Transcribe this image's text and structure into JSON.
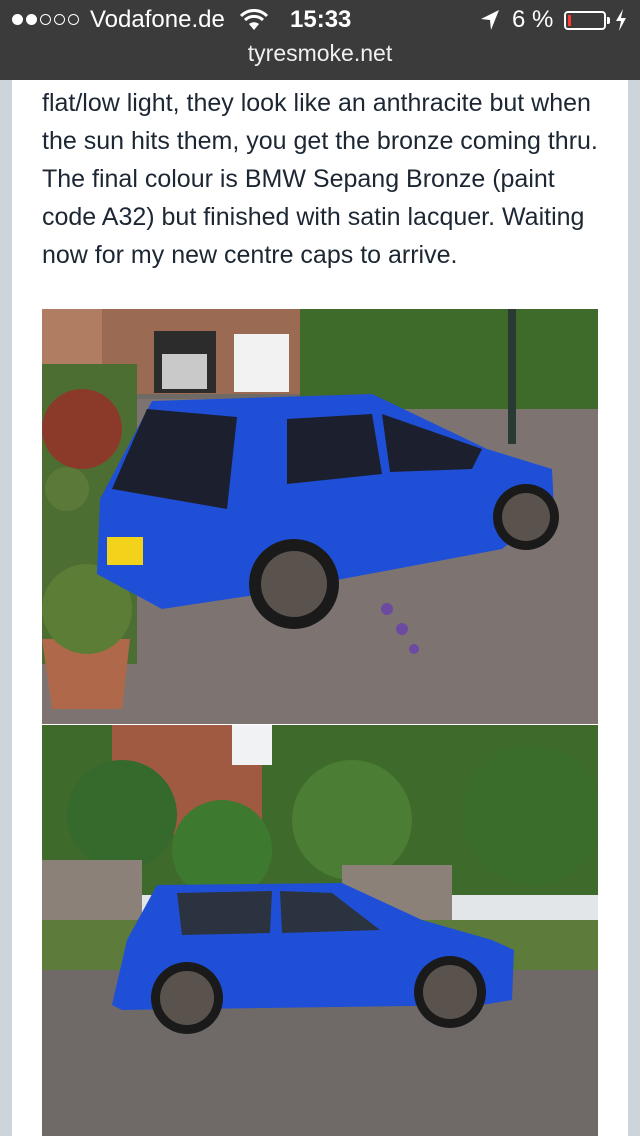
{
  "status_bar": {
    "carrier": "Vodafone.de",
    "time": "15:33",
    "battery_percent": "6 %",
    "signal_bars": 2,
    "icons": [
      "wifi-icon",
      "location-arrow-icon",
      "battery-icon",
      "charging-bolt-icon"
    ]
  },
  "browser": {
    "url": "tyresmoke.net"
  },
  "post": {
    "text": "flat/low light, they look like an anthracite but when the sun hits them, you get the bronze coming thru. The final colour is BMW Sepang Bronze (paint code A32) but finished with satin lacquer. Waiting now for my new centre caps to arrive."
  },
  "colors": {
    "car_blue": "#1f4fd6",
    "status_bar_bg": "#3b3b3b",
    "battery_low": "#ff3b30"
  }
}
